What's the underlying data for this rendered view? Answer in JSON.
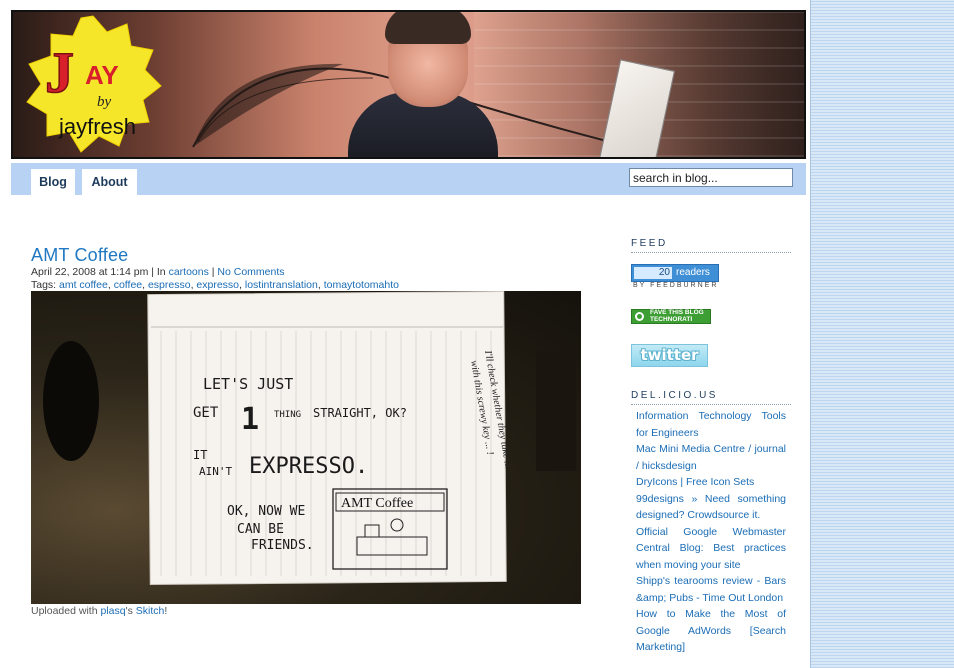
{
  "header": {
    "logo": {
      "letter": "J",
      "suffix": "AY",
      "by": "by",
      "name": "jayfresh"
    }
  },
  "nav": {
    "tabs": [
      {
        "label": "Blog"
      },
      {
        "label": "About"
      }
    ],
    "search_value": "search in blog..."
  },
  "post": {
    "title": "AMT Coffee",
    "date_prefix": "April 22, 2008 at 1:14 pm | In ",
    "category": "cartoons",
    "separator": " | ",
    "comments": "No Comments",
    "tags_label": "Tags: ",
    "tags": [
      "amt coffee",
      "coffee",
      "espresso",
      "expresso",
      "lostintranslation",
      "tomaytotomahto"
    ],
    "image": {
      "lines": [
        "LET'S JUST",
        "GET",
        "1",
        "THING",
        "STRAIGHT, OK?",
        "IT",
        "AIN'T",
        "EXPRESSO.",
        "OK, NOW WE",
        "CAN BE",
        "FRIENDS."
      ],
      "sign": "AMT Coffee",
      "side_note": "I'll check whether they take it...",
      "side_note_2": "with this screwy key ... !"
    },
    "caption_prefix": "Uploaded with ",
    "caption_link": "plasq",
    "caption_mid": "'s ",
    "caption_link2": "Skitch",
    "caption_suffix": "!"
  },
  "sidebar": {
    "feed_heading": "FEED",
    "feedburner_count": "20",
    "feedburner_label": "readers",
    "feedburner_by": "BY FEEDBURNER",
    "technorati": "FAVE THIS BLOG TECHNORATI",
    "twitter": "twitter",
    "delicious_heading": "DEL.ICIO.US",
    "delicious_links": [
      "Information Technology Tools for Engineers",
      "Mac Mini Media Centre / journal / hicksdesign",
      "DryIcons | Free Icon Sets",
      "99designs » Need something designed? Crowdsource it.",
      "Official Google Webmaster Central Blog: Best practices when moving your site",
      "Shipp's tearooms review - Bars &amp; Pubs - Time Out London",
      "How to Make the Most of Google AdWords [Search Marketing]"
    ]
  },
  "colors": {
    "accent": "#1f78c1",
    "nav_bar": "#b7d2f3",
    "logo_yellow": "#f6e62a",
    "logo_red": "#d8202b"
  }
}
